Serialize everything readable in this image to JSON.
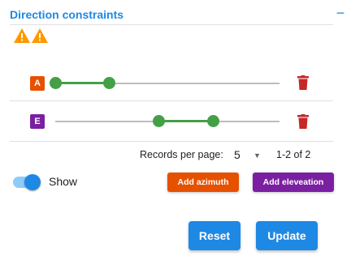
{
  "panel": {
    "title": "Direction constraints",
    "collapse_symbol": "−",
    "warning_icons": [
      "warning-icon",
      "warning-icon"
    ],
    "colors": {
      "accent": "#1e88e5",
      "warning": "#ff9800"
    }
  },
  "constraints": [
    {
      "badge": "A",
      "type": "azimuth",
      "badge_color": "#e65100",
      "range": [
        0,
        0.22
      ],
      "delete_icon": "trash-icon"
    },
    {
      "badge": "E",
      "type": "elevation",
      "badge_color": "#7b1fa2",
      "range": [
        0.43,
        0.68
      ],
      "delete_icon": "trash-icon"
    }
  ],
  "slider_colors": {
    "active": "#43a047",
    "inactive": "#bdbdbd",
    "delete": "#c62828"
  },
  "pagination": {
    "label": "Records per page:",
    "per_page": "5",
    "range_text": "1-2 of 2"
  },
  "toggle": {
    "label": "Show",
    "checked": true
  },
  "actions": {
    "add_azimuth": "Add azimuth",
    "add_elevation": "Add eleveation",
    "reset": "Reset",
    "update": "Update"
  }
}
